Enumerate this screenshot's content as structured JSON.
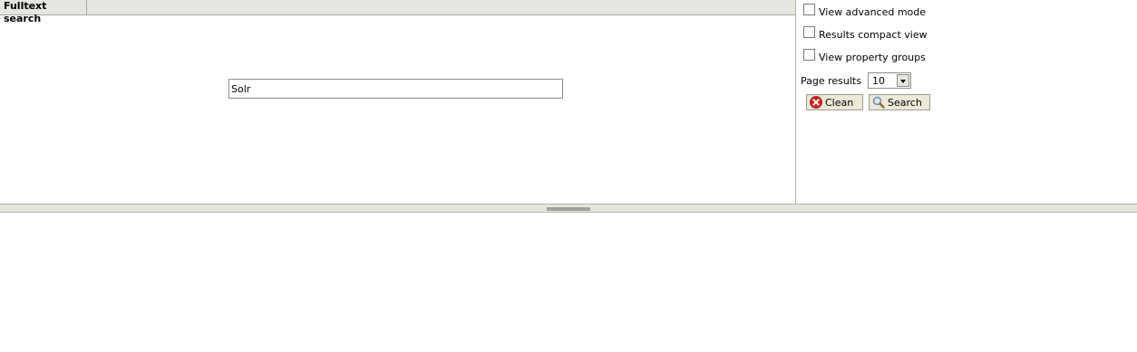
{
  "tabs": [
    {
      "label": "Fulltext search",
      "active": true
    }
  ],
  "search": {
    "value": "Solr"
  },
  "options": {
    "advanced_mode": {
      "label": "View advanced mode",
      "checked": false
    },
    "compact_view": {
      "label": "Results compact view",
      "checked": false
    },
    "property_groups": {
      "label": "View property groups",
      "checked": false
    }
  },
  "page_results": {
    "label": "Page results",
    "selected": "10"
  },
  "buttons": {
    "clean": {
      "label": "Clean",
      "icon": "red-x-icon"
    },
    "search": {
      "label": "Search",
      "icon": "magnifier-icon"
    }
  },
  "colors": {
    "chrome_bg": "#e6e5df",
    "border": "#a9a8a0",
    "clean_icon": "#d9211c",
    "button_bg": "#ece9d8"
  }
}
